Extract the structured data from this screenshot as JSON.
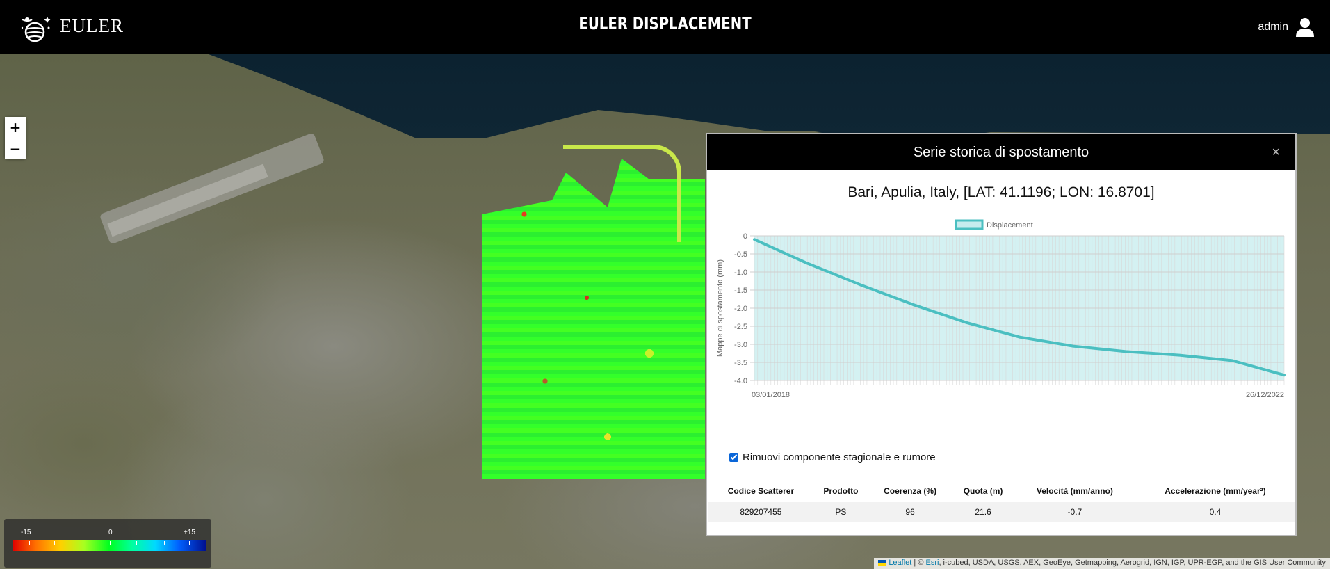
{
  "header": {
    "brand_name": "EULER",
    "app_title": "EULER DISPLACEMENT",
    "user_name": "admin"
  },
  "map": {
    "zoom_in_label": "+",
    "zoom_out_label": "−",
    "legend": {
      "min_label": "-15",
      "mid_label": "0",
      "max_label": "+15"
    },
    "attribution": {
      "leaflet": "Leaflet",
      "separator": " | © ",
      "esri": "Esri",
      "rest": ", i-cubed, USDA, USGS, AEX, GeoEye, Getmapping, Aerogrid, IGN, IGP, UPR-EGP, and the GIS User Community"
    }
  },
  "modal": {
    "title": "Serie storica di spostamento",
    "close_label": "×",
    "location": "Bari, Apulia, Italy, [LAT: 41.1196; LON: 16.8701]",
    "checkbox_label": "Rimuovi componente stagionale e rumore",
    "checkbox_checked": true,
    "table": {
      "headers": [
        "Codice Scatterer",
        "Prodotto",
        "Coerenza (%)",
        "Quota (m)",
        "Velocità (mm/anno)",
        "Accelerazione (mm/year²)"
      ],
      "rows": [
        [
          "829207455",
          "PS",
          "96",
          "21.6",
          "-0.7",
          "0.4"
        ]
      ]
    }
  },
  "chart_data": {
    "type": "area",
    "legend": [
      "Displacement"
    ],
    "legend_position": "top-center",
    "ylabel": "Mappe di spostamento (mm)",
    "xlabel": "",
    "x_tick_labels": [
      "03/01/2018",
      "26/12/2022"
    ],
    "ylim": [
      -4.0,
      0
    ],
    "y_ticks": [
      0,
      -0.5,
      -1.0,
      -1.5,
      -2.0,
      -2.5,
      -3.0,
      -3.5,
      -4.0
    ],
    "y_tick_labels": [
      "0",
      "-0.5",
      "-1.0",
      "-1.5",
      "-2.0",
      "-2.5",
      "-3.0",
      "-3.5",
      "-4.0"
    ],
    "grid": true,
    "series": [
      {
        "name": "Displacement",
        "color": "#4bbfc1",
        "fill": "#c6ecee",
        "x": [
          "2018-01-03",
          "2018-07-01",
          "2019-01-01",
          "2019-07-01",
          "2020-01-01",
          "2020-07-01",
          "2021-01-01",
          "2021-07-01",
          "2022-01-01",
          "2022-07-01",
          "2022-12-26"
        ],
        "y": [
          -0.1,
          -0.75,
          -1.35,
          -1.9,
          -2.4,
          -2.8,
          -3.05,
          -3.2,
          -3.3,
          -3.45,
          -3.85
        ]
      }
    ]
  }
}
